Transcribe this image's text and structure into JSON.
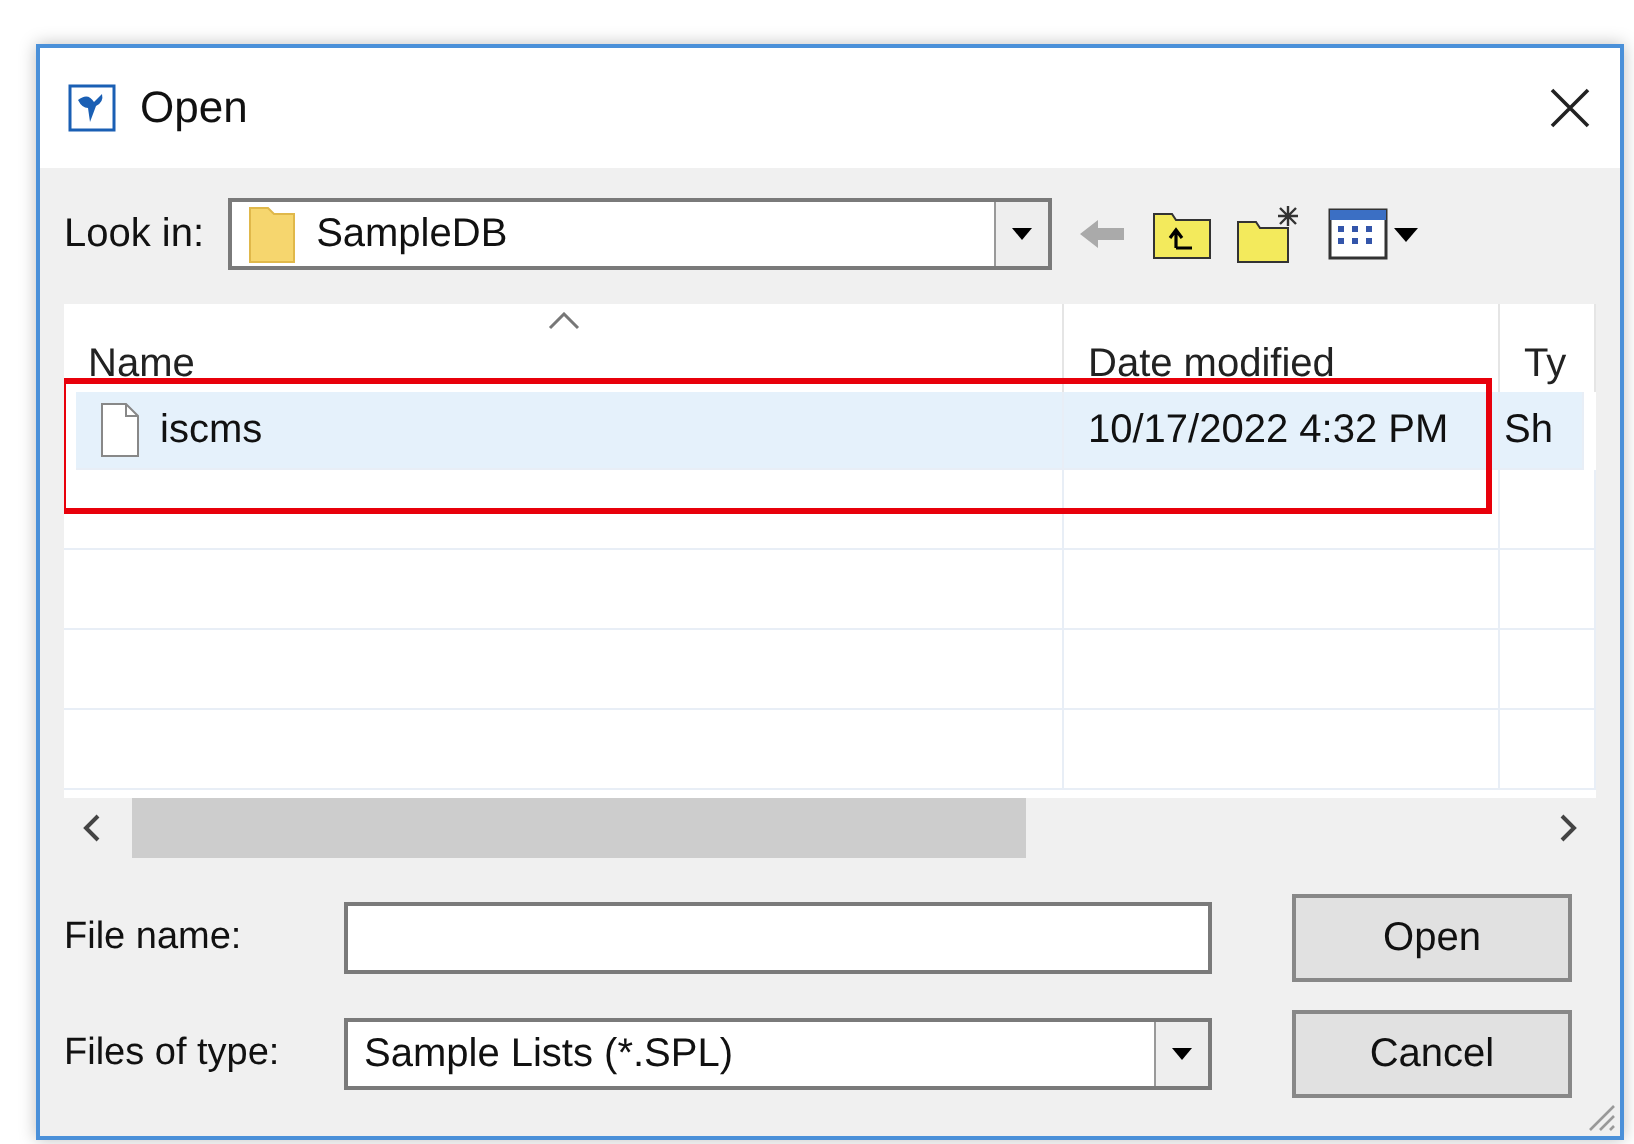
{
  "window": {
    "title": "Open"
  },
  "look_in": {
    "label": "Look in:",
    "value": "SampleDB"
  },
  "columns": [
    {
      "label": "Name",
      "sorted": true
    },
    {
      "label": "Date modified",
      "sorted": false
    },
    {
      "label": "Ty",
      "sorted": false
    }
  ],
  "rows": [
    {
      "name": "iscms",
      "date": "10/17/2022 4:32 PM",
      "type": "Sh",
      "selected": true
    }
  ],
  "file_name": {
    "label": "File name:"
  },
  "files_of_type": {
    "label": "Files of type:",
    "value": "Sample Lists (*.SPL)"
  },
  "buttons": [
    "Open",
    "Cancel"
  ]
}
